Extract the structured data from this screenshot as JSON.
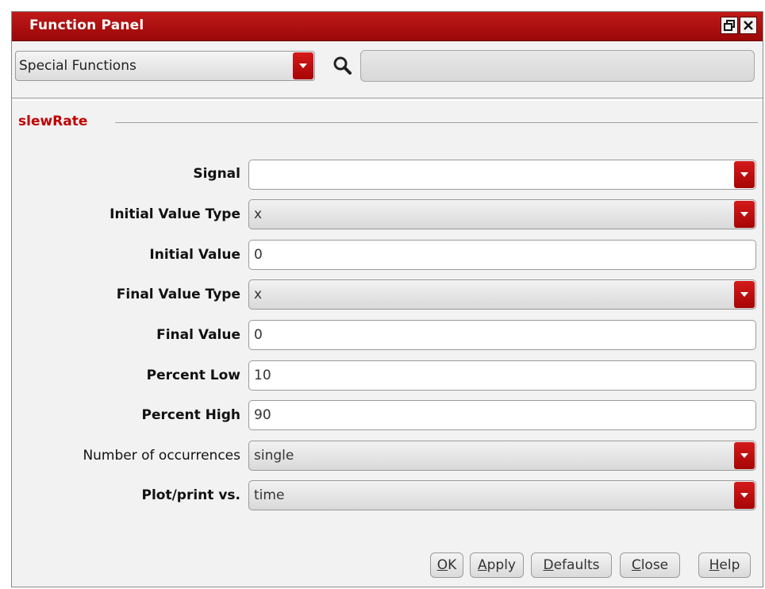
{
  "window": {
    "title": "Function Panel",
    "float_icon": "restore-icon",
    "close_icon": "close-icon"
  },
  "toolbar": {
    "category": "Special Functions",
    "search_icon": "search-icon",
    "search_value": ""
  },
  "function": {
    "name": "slewRate"
  },
  "form": {
    "signal": {
      "label": "Signal",
      "value": ""
    },
    "initial_value_type": {
      "label": "Initial Value Type",
      "value": "x"
    },
    "initial_value": {
      "label": "Initial Value",
      "value": "0"
    },
    "final_value_type": {
      "label": "Final Value Type",
      "value": "x"
    },
    "final_value": {
      "label": "Final Value",
      "value": "0"
    },
    "percent_low": {
      "label": "Percent Low",
      "value": "10"
    },
    "percent_high": {
      "label": "Percent High",
      "value": "90"
    },
    "number_of_occurrences": {
      "label": "Number of occurrences",
      "value": "single"
    },
    "plot_print_vs": {
      "label": "Plot/print vs.",
      "value": "time"
    }
  },
  "buttons": {
    "ok": {
      "mnemonic": "O",
      "rest": "K"
    },
    "apply": {
      "mnemonic": "A",
      "rest": "pply"
    },
    "defaults": {
      "mnemonic": "D",
      "rest": "efaults"
    },
    "close": {
      "mnemonic": "C",
      "rest": "lose"
    },
    "help": {
      "mnemonic": "H",
      "rest": "elp"
    }
  },
  "colors": {
    "accent": "#b00b0b",
    "function_name": "#c00000",
    "panel_bg": "#f2f2f2"
  }
}
